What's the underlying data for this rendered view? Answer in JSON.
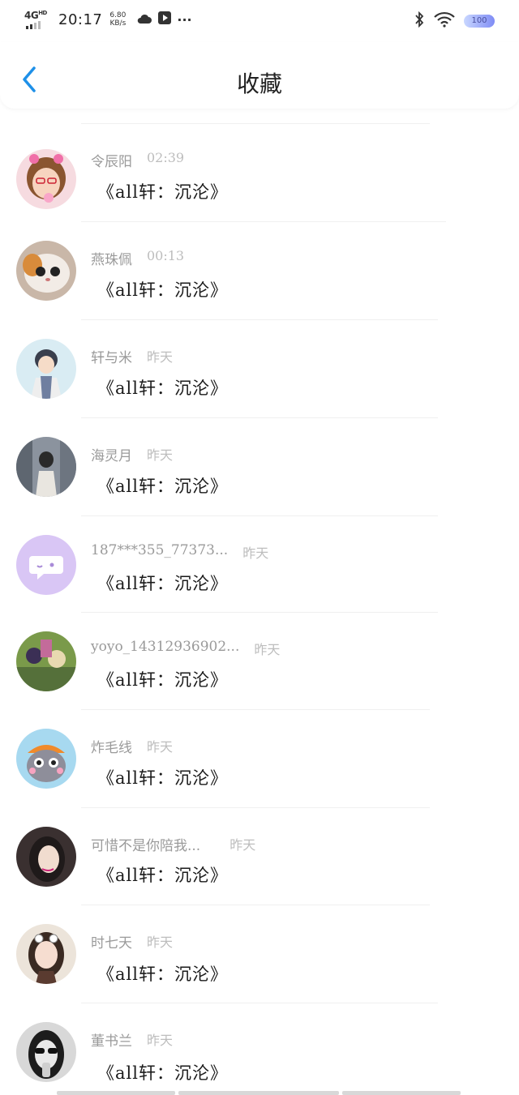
{
  "status": {
    "network": "4G",
    "network_sup": "HD",
    "time": "20:17",
    "speed_value": "6.80",
    "speed_unit": "KB/s",
    "more": "···",
    "battery": "100"
  },
  "header": {
    "title": "收藏"
  },
  "items": [
    {
      "name": "令辰阳",
      "time": "02:39",
      "message": "《all轩：沉沦》",
      "avatar": "avatar-pink-girl"
    },
    {
      "name": "燕珠佩",
      "time": "00:13",
      "message": "《all轩：沉沦》",
      "avatar": "avatar-cat"
    },
    {
      "name": "轩与米",
      "time": "昨天",
      "message": "《all轩：沉沦》",
      "avatar": "avatar-anime-boy"
    },
    {
      "name": "海灵月",
      "time": "昨天",
      "message": "《all轩：沉沦》",
      "avatar": "avatar-girl-street"
    },
    {
      "name": "187***355_77373...",
      "time": "昨天",
      "message": "《all轩：沉沦》",
      "avatar": "avatar-default-chat"
    },
    {
      "name": "yoyo_14312936902...",
      "time": "昨天",
      "message": "《all轩：沉沦》",
      "avatar": "avatar-anime-scene"
    },
    {
      "name": "炸毛线",
      "time": "昨天",
      "message": "《all轩：沉沦》",
      "avatar": "avatar-cartoon-cat"
    },
    {
      "name": "可惜不是你陪我...",
      "time": "昨天",
      "message": "《all轩：沉沦》",
      "avatar": "avatar-girl-dark"
    },
    {
      "name": "时七天",
      "time": "昨天",
      "message": "《all轩：沉沦》",
      "avatar": "avatar-girl-glasses"
    },
    {
      "name": "董书兰",
      "time": "昨天",
      "message": "《all轩：沉沦》",
      "avatar": "avatar-bw-sunglasses"
    }
  ],
  "colors": {
    "accent": "#1e90e8",
    "name": "#9a9a9a",
    "time": "#bdbdbd",
    "message": "#1a1a1a"
  }
}
